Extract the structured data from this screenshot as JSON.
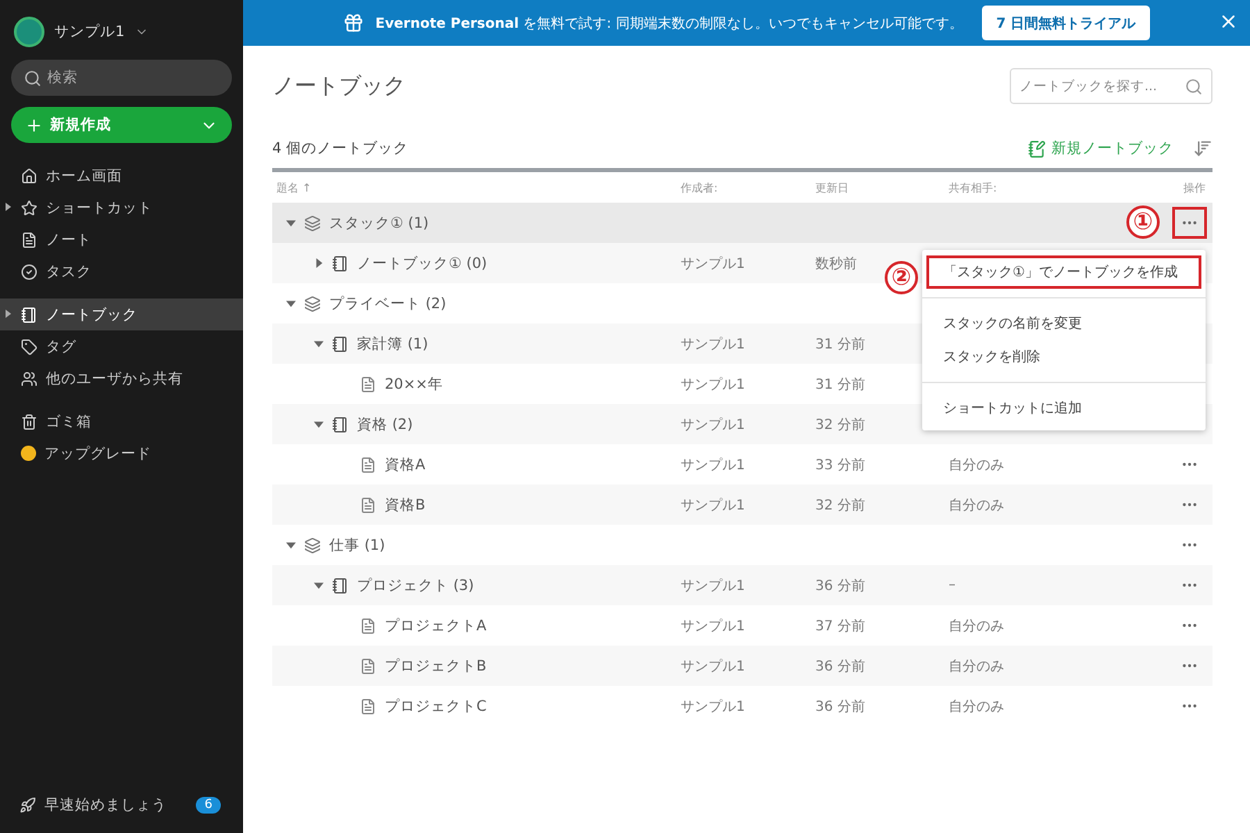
{
  "sidebar": {
    "account": {
      "name": "サンプル1"
    },
    "search": {
      "placeholder": "検索"
    },
    "new_button": {
      "label": "新規作成"
    },
    "nav_groups": [
      [
        {
          "label": "ホーム画面",
          "selected": false,
          "has_children": false
        },
        {
          "label": "ショートカット",
          "selected": false,
          "has_children": true
        },
        {
          "label": "ノート",
          "selected": false,
          "has_children": false
        },
        {
          "label": "タスク",
          "selected": false,
          "has_children": false
        }
      ],
      [
        {
          "label": "ノートブック",
          "selected": true,
          "has_children": true
        },
        {
          "label": "タグ",
          "selected": false,
          "has_children": false
        },
        {
          "label": "他のユーザから共有",
          "selected": false,
          "has_children": false
        }
      ],
      [
        {
          "label": "ゴミ箱",
          "selected": false,
          "has_children": false
        },
        {
          "label": "アップグレード",
          "selected": false,
          "has_children": false
        }
      ]
    ],
    "footer": {
      "label": "早速始めましょう",
      "badge": "6"
    }
  },
  "banner": {
    "text": "**Evernote Personal** を無料で試す: 同期端末数の制限なし。いつでもキャンセル可能です。",
    "button": "7 日間無料トライアル"
  },
  "page": {
    "title": "ノートブック",
    "search": {
      "placeholder": "ノートブックを探す..."
    },
    "count": "4 個のノートブック",
    "new_notebook": "新規ノートブック"
  },
  "table": {
    "columns": [
      "題名 ↑",
      "作成者:",
      "更新日",
      "共有相手:",
      "操作"
    ],
    "rows": [
      {
        "kind": "stack",
        "title": "スタック① (1)",
        "expanded": true,
        "selected": true,
        "children": [
          {
            "kind": "notebook",
            "title": "ノートブック① (0)",
            "expanded": false,
            "selected": false,
            "creator": "サンプル1",
            "updated": "数秒前"
          }
        ]
      },
      {
        "kind": "stack",
        "title": "プライベート (2)",
        "expanded": true,
        "selected": false,
        "children": [
          {
            "kind": "notebook",
            "title": "家計簿 (1)",
            "expanded": true,
            "selected": false,
            "creator": "サンプル1",
            "updated": "31 分前",
            "children": [
              {
                "kind": "note",
                "title": "20××年",
                "selected": false,
                "creator": "サンプル1",
                "updated": "31 分前"
              }
            ]
          },
          {
            "kind": "notebook",
            "title": "資格 (2)",
            "expanded": true,
            "selected": false,
            "creator": "サンプル1",
            "updated": "32 分前",
            "children": [
              {
                "kind": "note",
                "title": "資格A",
                "selected": false,
                "creator": "サンプル1",
                "updated": "33 分前",
                "shared": "自分のみ"
              },
              {
                "kind": "note",
                "title": "資格B",
                "selected": false,
                "creator": "サンプル1",
                "updated": "32 分前",
                "shared": "自分のみ"
              }
            ]
          }
        ]
      },
      {
        "kind": "stack",
        "title": "仕事 (1)",
        "expanded": true,
        "selected": false,
        "children": [
          {
            "kind": "notebook",
            "title": "プロジェクト (3)",
            "expanded": true,
            "selected": false,
            "creator": "サンプル1",
            "updated": "36 分前",
            "shared": "–",
            "children": [
              {
                "kind": "note",
                "title": "プロジェクトA",
                "selected": false,
                "creator": "サンプル1",
                "updated": "37 分前",
                "shared": "自分のみ"
              },
              {
                "kind": "note",
                "title": "プロジェクトB",
                "selected": false,
                "creator": "サンプル1",
                "updated": "36 分前",
                "shared": "自分のみ"
              },
              {
                "kind": "note",
                "title": "プロジェクトC",
                "selected": false,
                "creator": "サンプル1",
                "updated": "36 分前",
                "shared": "自分のみ"
              }
            ]
          }
        ]
      }
    ]
  },
  "context_menu": {
    "groups": [
      [
        "「スタック①」でノートブックを作成"
      ],
      [
        "スタックの名前を変更",
        "スタックを削除"
      ],
      [
        "ショートカットに追加"
      ]
    ]
  },
  "annotations": [
    {
      "label": "①"
    },
    {
      "label": "②"
    }
  ]
}
